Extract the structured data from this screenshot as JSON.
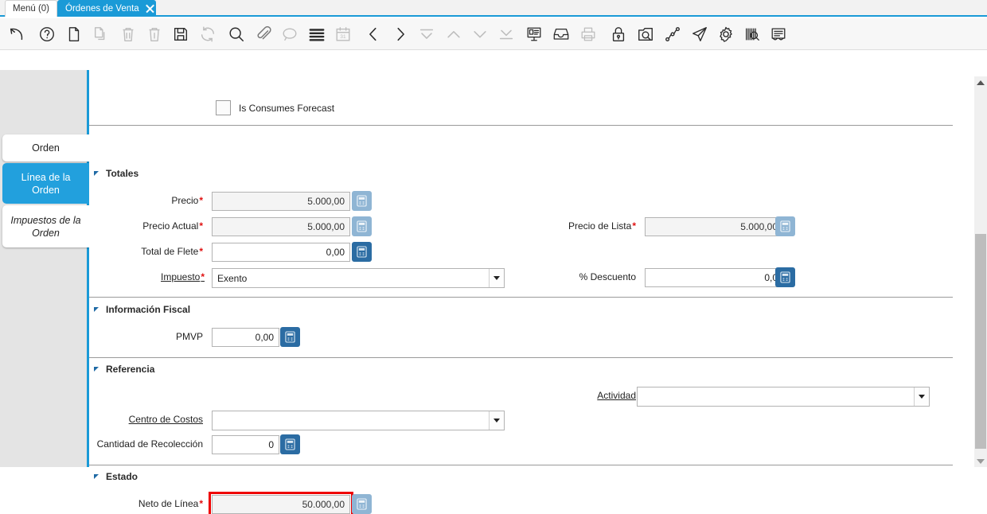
{
  "window_tabs": [
    {
      "label": "Menú (0)",
      "active": false,
      "closable": false
    },
    {
      "label": "Órdenes de Venta",
      "active": true,
      "closable": true
    }
  ],
  "toolbar": {
    "buttons": [
      {
        "name": "undo-icon",
        "title": "Deshacer",
        "enabled": true
      },
      {
        "name": "help-icon",
        "title": "Ayuda",
        "enabled": true
      },
      {
        "name": "new-record-icon",
        "title": "Nuevo Registro",
        "enabled": true
      },
      {
        "name": "copy-icon",
        "title": "Copiar Registro",
        "enabled": false
      },
      {
        "name": "delete-icon",
        "title": "Eliminar Registro",
        "enabled": false
      },
      {
        "name": "delete-all-icon",
        "title": "Eliminar Todo",
        "enabled": false
      },
      {
        "name": "save-icon",
        "title": "Guardar Cambios",
        "enabled": true
      },
      {
        "name": "refresh-icon",
        "title": "Actualizar",
        "enabled": false
      },
      {
        "name": "search-icon",
        "title": "Buscar",
        "enabled": true
      },
      {
        "name": "attachment-icon",
        "title": "Adjunto",
        "enabled": true
      },
      {
        "name": "chat-icon",
        "title": "Nota",
        "enabled": false
      },
      {
        "name": "grid-toggle-icon",
        "title": "Cambiar Vista",
        "enabled": true
      },
      {
        "name": "calendar-icon",
        "title": "Calendario",
        "enabled": false
      },
      {
        "name": "prev-record-icon",
        "title": "Registro Anterior",
        "enabled": true
      },
      {
        "name": "next-record-icon",
        "title": "Registro Siguiente",
        "enabled": true
      },
      {
        "name": "first-record-icon",
        "title": "Primer Registro",
        "enabled": false
      },
      {
        "name": "up-icon",
        "title": "Arriba",
        "enabled": false
      },
      {
        "name": "down-icon",
        "title": "Abajo",
        "enabled": false
      },
      {
        "name": "last-record-icon",
        "title": "Último Registro",
        "enabled": false
      },
      {
        "name": "report-icon",
        "title": "Reporte",
        "enabled": true
      },
      {
        "name": "archive-icon",
        "title": "Archivo",
        "enabled": true
      },
      {
        "name": "print-icon",
        "title": "Imprimir",
        "enabled": false
      },
      {
        "name": "lock-icon",
        "title": "Bloquear Registro",
        "enabled": true
      },
      {
        "name": "zoom-across-icon",
        "title": "Zoom",
        "enabled": true
      },
      {
        "name": "workflow-icon",
        "title": "Flujo de Trabajo",
        "enabled": true
      },
      {
        "name": "send-icon",
        "title": "Enviar Correo",
        "enabled": true
      },
      {
        "name": "settings-icon",
        "title": "Preferencias",
        "enabled": true
      },
      {
        "name": "barcode-icon",
        "title": "Código de Barras",
        "enabled": true
      },
      {
        "name": "document-icon",
        "title": "Documento",
        "enabled": true
      }
    ]
  },
  "rail_tabs": [
    {
      "label": "Orden",
      "selected": false,
      "italic": false
    },
    {
      "label": "Línea de la Orden",
      "selected": true,
      "italic": false
    },
    {
      "label": "Impuestos de la Orden",
      "selected": false,
      "italic": true
    }
  ],
  "checkbox": {
    "label": "Is Consumes Forecast",
    "checked": false
  },
  "sections": {
    "totales": "Totales",
    "informacion_fiscal": "Información Fiscal",
    "referencia": "Referencia",
    "estado": "Estado"
  },
  "fields": {
    "precio": {
      "label": "Precio",
      "value": "5.000,00",
      "required": true,
      "readonly": true,
      "button": "off"
    },
    "precio_actual": {
      "label": "Precio Actual",
      "value": "5.000,00",
      "required": true,
      "readonly": true,
      "button": "off"
    },
    "total_flete": {
      "label": "Total de Flete",
      "value": "0,00",
      "required": true,
      "readonly": false,
      "button": "on"
    },
    "impuesto": {
      "label": "Impuesto",
      "value": "Exento",
      "required": true
    },
    "precio_lista": {
      "label": "Precio de Lista",
      "value": "5.000,00",
      "required": true,
      "readonly": true,
      "button": "off"
    },
    "descuento": {
      "label": "% Descuento",
      "value": "0,0",
      "required": false,
      "readonly": false,
      "button": "on"
    },
    "pmvp": {
      "label": "PMVP",
      "value": "0,00",
      "required": false,
      "readonly": false,
      "button": "on"
    },
    "actividad": {
      "label": "Actividad",
      "value": ""
    },
    "centro_costos": {
      "label": "Centro de Costos",
      "value": ""
    },
    "cantidad_recoleccion": {
      "label": "Cantidad de Recolección",
      "value": "0",
      "required": false,
      "readonly": false,
      "button": "on"
    },
    "neto_linea": {
      "label": "Neto de Línea",
      "value": "50.000,00",
      "required": true,
      "readonly": true,
      "button": "off",
      "highlighted": true
    }
  },
  "colors": {
    "accent_blue": "#1a9ad7",
    "tab_selected": "#22a0dd",
    "calc_button_active": "#2b6ca3",
    "calc_button_disabled": "#8fb5d4",
    "required_star": "#e01010",
    "highlight_border": "#ee0000",
    "rail_background": "#e4e4e4"
  }
}
